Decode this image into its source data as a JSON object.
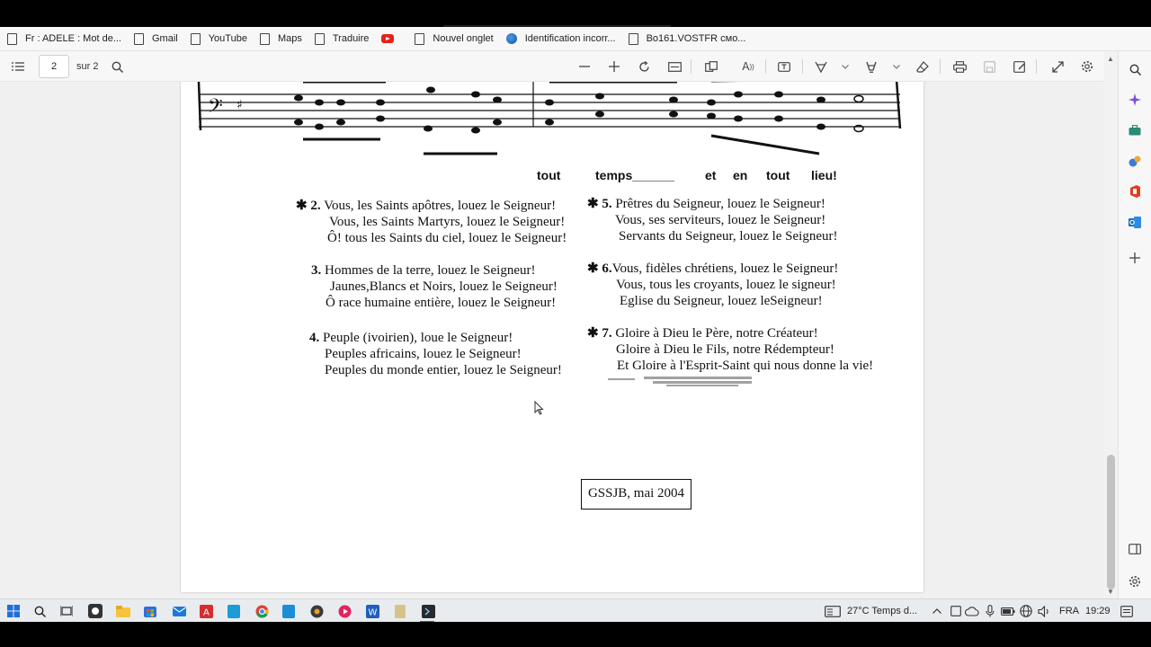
{
  "bookmarks": [
    {
      "label": "Fr : ADELE : Mot de...",
      "icon": "page-icon"
    },
    {
      "label": "Gmail",
      "icon": "page-icon"
    },
    {
      "label": "YouTube",
      "icon": "page-icon"
    },
    {
      "label": "Maps",
      "icon": "page-icon"
    },
    {
      "label": "Traduire",
      "icon": "page-icon"
    },
    {
      "label": "",
      "icon": "youtube-icon"
    },
    {
      "label": "Nouvel onglet",
      "icon": "page-icon"
    },
    {
      "label": "Identification incorr...",
      "icon": "globe-icon"
    },
    {
      "label": "Bo161.VOSTFR смо...",
      "icon": "page-icon"
    }
  ],
  "pdf_toolbar": {
    "page_number": "2",
    "of_pages": "sur 2"
  },
  "song": {
    "refrain_words": [
      "tout",
      "temps______",
      "et",
      "en",
      "tout",
      "lieu!"
    ],
    "left_column": [
      {
        "number": "2.",
        "lines": [
          "Vous, les Saints apôtres, louez le Seigneur!",
          "Vous, les Saints Martyrs, louez le Seigneur!",
          "Ô! tous les Saints du ciel, louez le Seigneur!"
        ]
      },
      {
        "number": "3.",
        "lines": [
          "Hommes de la terre, louez le Seigneur!",
          "Jaunes,Blancs et Noirs, louez le Seigneur!",
          "Ô race humaine entière, louez le Seigneur!"
        ]
      },
      {
        "number": "4.",
        "lines": [
          "Peuple (ivoirien), loue le Seigneur!",
          "Peuples africains, louez le Seigneur!",
          "Peuples du monde entier, louez le Seigneur!"
        ]
      }
    ],
    "right_column": [
      {
        "number": "5.",
        "lines": [
          "Prêtres du Seigneur, louez le Seigneur!",
          "Vous, ses serviteurs, louez le Seigneur!",
          "Servants du Seigneur, louez le Seigneur!"
        ]
      },
      {
        "number": "6.",
        "lines": [
          "Vous, fidèles chrétiens, louez le Seigneur!",
          "Vous, tous les croyants, louez le signeur!",
          "Eglise du Seigneur, louez leSeigneur!"
        ]
      },
      {
        "number": "7.",
        "lines": [
          "Gloire à Dieu le Père, notre Créateur!",
          "Gloire à Dieu le Fils, notre Rédempteur!",
          "Et Gloire à l'Esprit-Saint qui nous donne la vie!"
        ]
      }
    ],
    "stamp": "GSSJB, mai 2004"
  },
  "taskbar": {
    "weather": "27°C  Temps d...",
    "language": "FRA",
    "time": "19:29"
  },
  "colors": {
    "toolbar_bg": "#f7f7f7",
    "viewer_bg": "#f0f0f0",
    "taskbar_bg": "#e9ecef"
  }
}
